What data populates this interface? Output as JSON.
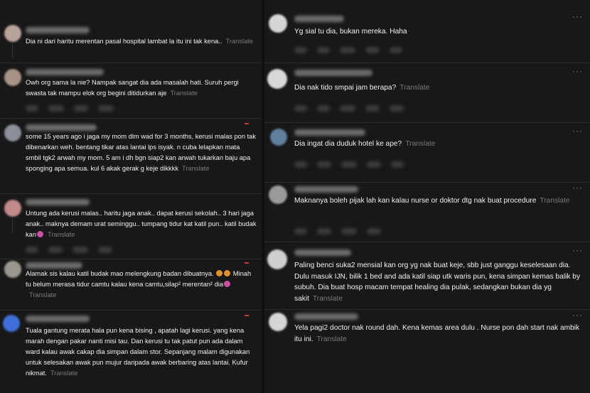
{
  "ui": {
    "translate_label": "Translate",
    "more_icon": "more-options-icon"
  },
  "left_comments": [
    {
      "text": "Dia ni dari haritu merentan pasal hospital lambat la itu ini tak kena.."
    },
    {
      "text": "Owh org sama la nie? Nampak sangat dia ada masalah hati. Suruh pergi swasta tak mampu elok org begini ditidurkan aje"
    },
    {
      "text": "some 15 years ago i jaga my mom dlm wad for 3 months, kerusi malas pon tak dibenarkan weh. bentang tikar atas lantai lps isyak. n cuba lelapkan mata smbil tgk2 arwah my mom. 5 am i dh bgn siap2 kan arwah tukarkan baju apa sponging apa semua. kul 6 akak gerak g keje dikkkk"
    },
    {
      "text": "Untung ada kerusi malas.. haritu jaga anak.. dapat kerusi sekolah.. 3 hari jaga anak.. maknya demam urat seminggu.. tumpang tidur kat katil pun.. katil budak kan"
    },
    {
      "text_a": "Alamak sis kalau katil budak mao melengkung badan dibuatnya.",
      "text_b": "Minah tu belum merasa tidur camtu kalau kena camtu,silap² merentan² dia"
    },
    {
      "text": "Tuala gantung merata hala pun kena bising , apatah lagi kerusi. yang kena marah dengan pakar nanti misi tau. Dan kerusi tu tak patut pun ada dalam ward kalau awak cakap dia simpan dalam stor. Sepanjang malam digunakan untuk selesakan awak pun mujur daripada awak berbaring atas lantai. Kufur nikmat."
    }
  ],
  "right_comments": [
    {
      "text": "Yg sial tu dia, bukan mereka. Haha"
    },
    {
      "text": "Dia nak tido smpai jam berapa?"
    },
    {
      "text": "Dia ingat dia duduk hotel ke ape?"
    },
    {
      "text": "Maknanya boleh pijak lah kan kalau nurse or doktor dtg nak buat procedure"
    },
    {
      "text": "Paling benci suka2 mensial kan org yg nak buat keje, sbb just ganggu keselesaan dia. Dulu masuk IJN, bilik 1 bed and ada katil siap utk waris pun, kena simpan kemas balik by subuh. Dia buat hosp macam tempat healing dia pulak, sedangkan bukan dia yg sakit"
    },
    {
      "text": "Yela pagi2 doctor nak round dah. Kena kemas area dulu . Nurse pon dah start nak ambik itu ini."
    }
  ]
}
